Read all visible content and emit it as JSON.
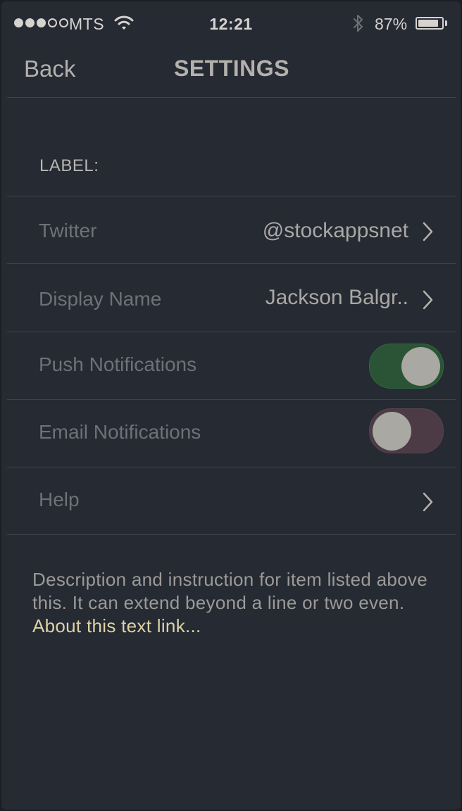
{
  "status_bar": {
    "signal_dots": 5,
    "signal_filled": 3,
    "carrier": "MTS",
    "time": "12:21",
    "battery_text": "87%",
    "battery_level": 0.87,
    "icons": [
      "wifi-icon",
      "bluetooth-icon",
      "battery-icon"
    ]
  },
  "nav": {
    "back_label": "Back",
    "title": "SETTINGS"
  },
  "section": {
    "label": "LABEL:"
  },
  "rows": {
    "twitter": {
      "label": "Twitter",
      "value": "@stockappsnet",
      "icon": "chevron-right-icon"
    },
    "display_name": {
      "label": "Display Name",
      "value": "Jackson Balgr..",
      "icon": "chevron-right-icon"
    },
    "push_notifications": {
      "label": "Push Notifications",
      "enabled": true
    },
    "email_notifications": {
      "label": "Email Notifications",
      "enabled": false
    },
    "help": {
      "label": "Help",
      "icon": "chevron-right-icon"
    }
  },
  "footer": {
    "description": "Description and instruction for item listed above this. It can extend beyond a line or two even.",
    "link_text": "About this text link..."
  },
  "colors": {
    "background": "#252a33",
    "toggle_on": "#2a5435",
    "toggle_off": "#4c3b45",
    "link": "#ddd2a5"
  }
}
